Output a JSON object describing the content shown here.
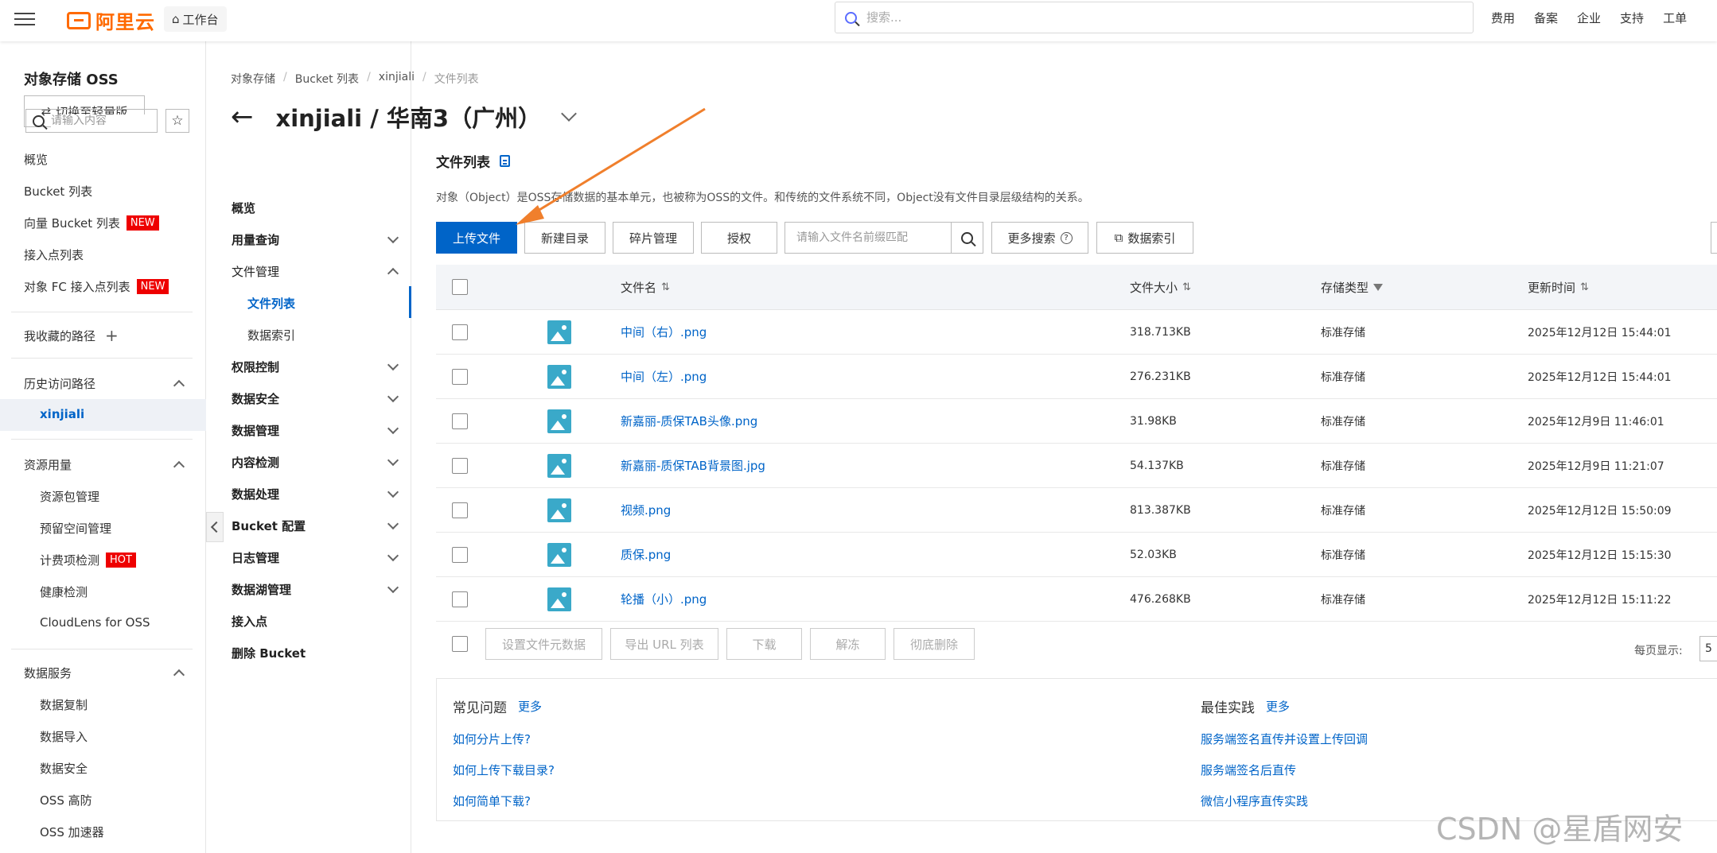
{
  "topbar": {
    "logo_text": "阿里云",
    "workbench": "工作台",
    "search_placeholder": "搜索...",
    "links": [
      "费用",
      "备案",
      "企业",
      "支持",
      "工单"
    ]
  },
  "sidebar": {
    "title": "对象存储 OSS",
    "switch_label": "切换至轻量版",
    "items": [
      {
        "label": "概览"
      },
      {
        "label": "Bucket 列表"
      },
      {
        "label": "向量 Bucket 列表",
        "badge": "NEW"
      },
      {
        "label": "接入点列表"
      },
      {
        "label": "对象 FC 接入点列表",
        "badge": "NEW"
      }
    ],
    "favorites": "我收藏的路径",
    "history": {
      "label": "历史访问路径",
      "active": "xinjiali"
    },
    "resources": {
      "label": "资源用量",
      "items": [
        "资源包管理",
        "预留空间管理",
        "计费项检测",
        "健康检测",
        "CloudLens for OSS"
      ],
      "hot_badge": "HOT"
    },
    "data_services": {
      "label": "数据服务",
      "items": [
        "数据复制",
        "数据导入",
        "数据安全",
        "OSS 高防",
        "OSS 加速器"
      ]
    }
  },
  "breadcrumb": [
    "对象存储",
    "Bucket 列表",
    "xinjiali",
    "文件列表"
  ],
  "page_title": "xinjiali / 华南3（广州）",
  "nav": {
    "search_placeholder": "请输入内容",
    "overview": "概览",
    "usage": "用量查询",
    "file_mgmt": "文件管理",
    "file_list": "文件列表",
    "data_index": "数据索引",
    "permission": "权限控制",
    "data_security": "数据安全",
    "data_mgmt": "数据管理",
    "content_check": "内容检测",
    "data_process": "数据处理",
    "bucket_config": "Bucket 配置",
    "log_mgmt": "日志管理",
    "datalake": "数据湖管理",
    "access_point": "接入点",
    "delete_bucket": "删除 Bucket"
  },
  "main": {
    "title": "文件列表",
    "description": "对象（Object）是OSS存储数据的基本单元，也被称为OSS的文件。和传统的文件系统不同，Object没有文件目录层级结构的关系。",
    "toolbar": {
      "upload": "上传文件",
      "new_dir": "新建目录",
      "fragments": "碎片管理",
      "authorize": "授权",
      "search_placeholder": "请输入文件名前缀匹配",
      "more_search": "更多搜索",
      "data_index": "数据索引"
    },
    "table": {
      "headers": {
        "name": "文件名",
        "size": "文件大小",
        "storage": "存储类型",
        "updated": "更新时间"
      },
      "rows": [
        {
          "name": "中间（右）.png",
          "size": "318.713KB",
          "storage": "标准存储",
          "updated": "2025年12月12日 15:44:01"
        },
        {
          "name": "中间（左）.png",
          "size": "276.231KB",
          "storage": "标准存储",
          "updated": "2025年12月12日 15:44:01"
        },
        {
          "name": "新嘉丽-质保TAB头像.png",
          "size": "31.98KB",
          "storage": "标准存储",
          "updated": "2025年12月9日 11:46:01"
        },
        {
          "name": "新嘉丽-质保TAB背景图.jpg",
          "size": "54.137KB",
          "storage": "标准存储",
          "updated": "2025年12月9日 11:21:07"
        },
        {
          "name": "视频.png",
          "size": "813.387KB",
          "storage": "标准存储",
          "updated": "2025年12月12日 15:50:09"
        },
        {
          "name": "质保.png",
          "size": "52.03KB",
          "storage": "标准存储",
          "updated": "2025年12月12日 15:15:30"
        },
        {
          "name": "轮播（小）.png",
          "size": "476.268KB",
          "storage": "标准存储",
          "updated": "2025年12月12日 15:11:22"
        }
      ]
    },
    "batch": [
      "设置文件元数据",
      "导出 URL 列表",
      "下载",
      "解冻",
      "彻底删除"
    ],
    "page_size_label": "每页显示:",
    "page_size_value": "5"
  },
  "faq": {
    "title": "常见问题",
    "more": "更多",
    "links": [
      "如何分片上传?",
      "如何上传下载目录?",
      "如何简单下载?"
    ]
  },
  "best": {
    "title": "最佳实践",
    "more": "更多",
    "links": [
      "服务端签名直传并设置上传回调",
      "服务端签名后直传",
      "微信小程序直传实践"
    ]
  },
  "watermark": "CSDN @星盾网安",
  "colors": {
    "primary": "#0064c8",
    "brand": "#ff6a00",
    "badge": "#e00000",
    "annotation_arrow": "#f07f2c"
  }
}
